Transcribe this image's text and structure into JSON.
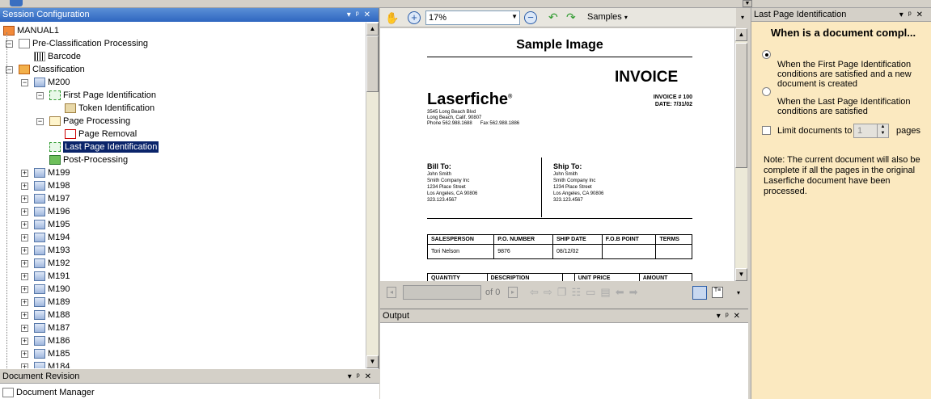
{
  "session_panel": {
    "title": "Session Configuration",
    "tree": [
      {
        "label": "MANUAL1"
      },
      {
        "label": "Pre-Classification Processing"
      },
      {
        "label": "Barcode"
      },
      {
        "label": "Classification"
      },
      {
        "label": "M200"
      },
      {
        "label": "First Page Identification"
      },
      {
        "label": "Token Identification"
      },
      {
        "label": "Page Processing"
      },
      {
        "label": "Page Removal"
      },
      {
        "label": "Last Page Identification"
      },
      {
        "label": "Post-Processing"
      },
      {
        "label": "M199"
      },
      {
        "label": "M198"
      },
      {
        "label": "M197"
      },
      {
        "label": "M196"
      },
      {
        "label": "M195"
      },
      {
        "label": "M194"
      },
      {
        "label": "M193"
      },
      {
        "label": "M192"
      },
      {
        "label": "M191"
      },
      {
        "label": "M190"
      },
      {
        "label": "M189"
      },
      {
        "label": "M188"
      },
      {
        "label": "M187"
      },
      {
        "label": "M186"
      },
      {
        "label": "M185"
      },
      {
        "label": "M184"
      }
    ],
    "selected_index": 9
  },
  "revision_panel": {
    "title": "Document Revision",
    "item": "Document Manager"
  },
  "viewer": {
    "zoom": "17%",
    "samples_label": "Samples",
    "page_of": "of 0",
    "page_value": ""
  },
  "sample": {
    "heading": "Sample Image",
    "invoice_title": "INVOICE",
    "company": "Laserfiche",
    "trademark": "®",
    "address1": "3545 Long Beach Blvd",
    "address2": "Long Beach, Calif. 90807",
    "phone": "Phone 562.988.1688",
    "fax": "Fax 562.988.1886",
    "invoice_no": "INVOICE # 100",
    "date": "DATE: 7/31/02",
    "bill_to": "Bill To:",
    "ship_to": "Ship To:",
    "contact": [
      "John Smith",
      "Smith Company Inc",
      "1234  Place Street",
      "Los Angeles, CA  90806",
      "323.123.4567"
    ],
    "table1_headers": [
      "SALESPERSON",
      "P.O. NUMBER",
      "SHIP DATE",
      "F.O.B POINT",
      "TERMS"
    ],
    "table1_row": [
      "Tori Nelson",
      "9876",
      "08/12/02",
      "",
      ""
    ],
    "table2_headers": [
      "QUANTITY",
      "DESCRIPTION",
      "",
      "UNIT PRICE",
      "AMOUNT"
    ]
  },
  "output_panel": {
    "title": "Output"
  },
  "right_panel": {
    "title": "Last Page Identification",
    "heading": "When is a document compl...",
    "option1": "When the First Page Identification conditions are satisfied and a new document is created",
    "option2": "When the Last Page Identification conditions are satisfied",
    "limit_label": "Limit documents to",
    "limit_value": "1",
    "pages_label": "pages",
    "note": "Note: The current document will also be complete if all the pages in the original Laserfiche document have been processed."
  }
}
